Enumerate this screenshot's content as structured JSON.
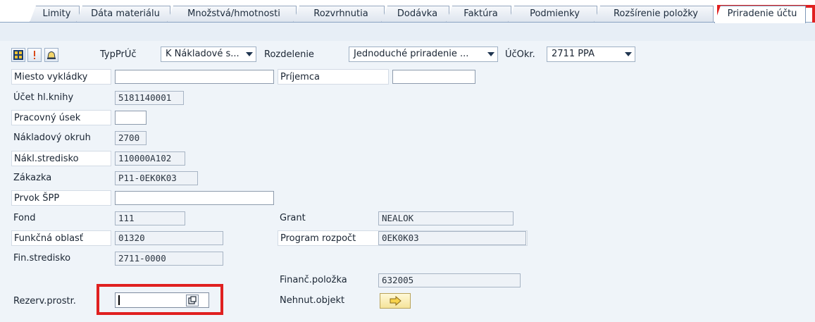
{
  "tabs": [
    {
      "label": "Limity",
      "active": false
    },
    {
      "label": "Dáta materiálu",
      "active": false
    },
    {
      "label": "Množstvá/hmotnosti",
      "active": false
    },
    {
      "label": "Rozvrhnutia",
      "active": false
    },
    {
      "label": "Dodávka",
      "active": false
    },
    {
      "label": "Faktúra",
      "active": false
    },
    {
      "label": "Podmienky",
      "active": false
    },
    {
      "label": "Rozšírenie položky",
      "active": false
    },
    {
      "label": "Priradenie účtu",
      "active": true
    }
  ],
  "toolbar": {
    "icons": [
      "grid-table-icon",
      "info-exclamation-icon",
      "bell-icon"
    ],
    "typpruc_label": "TypPrÚč",
    "typpruc_value": "K Nákladové s...",
    "rozdelenie_label": "Rozdelenie",
    "rozdelenie_value": "Jednoduché priradenie ...",
    "ucokr_label": "ÚčOkr.",
    "ucokr_value": "2711 PPA"
  },
  "left_fields": [
    {
      "label": "Miesto vykládky",
      "value": ""
    },
    {
      "label": "Účet hl.knihy",
      "value": "5181140001"
    },
    {
      "label": "Pracovný úsek",
      "value": ""
    },
    {
      "label": "Nákladový okruh",
      "value": "2700"
    },
    {
      "label": "Nákl.stredisko",
      "value": "110000A102"
    },
    {
      "label": "Zákazka",
      "value": "P11-0EK0K03"
    },
    {
      "label": "Prvok ŠPP",
      "value": ""
    },
    {
      "label": "Fond",
      "value": "111"
    },
    {
      "label": "Funkčná oblasť",
      "value": "01320"
    },
    {
      "label": "Fin.stredisko",
      "value": "2711-0000"
    },
    {
      "label": "Rezerv.prostr.",
      "value": ""
    }
  ],
  "right_fields": [
    {
      "label": "Príjemca",
      "value": ""
    },
    {
      "label": "Grant",
      "value": "NEALOK"
    },
    {
      "label": "Program rozpočt",
      "value": "0EK0K03"
    },
    {
      "label": "Finanč.položka",
      "value": "632005"
    },
    {
      "label": "Nehnut.objekt",
      "value": ""
    }
  ],
  "colors": {
    "highlight": "#e02020",
    "form_background": "#eff4f9",
    "tab_active": "#ffffff"
  }
}
